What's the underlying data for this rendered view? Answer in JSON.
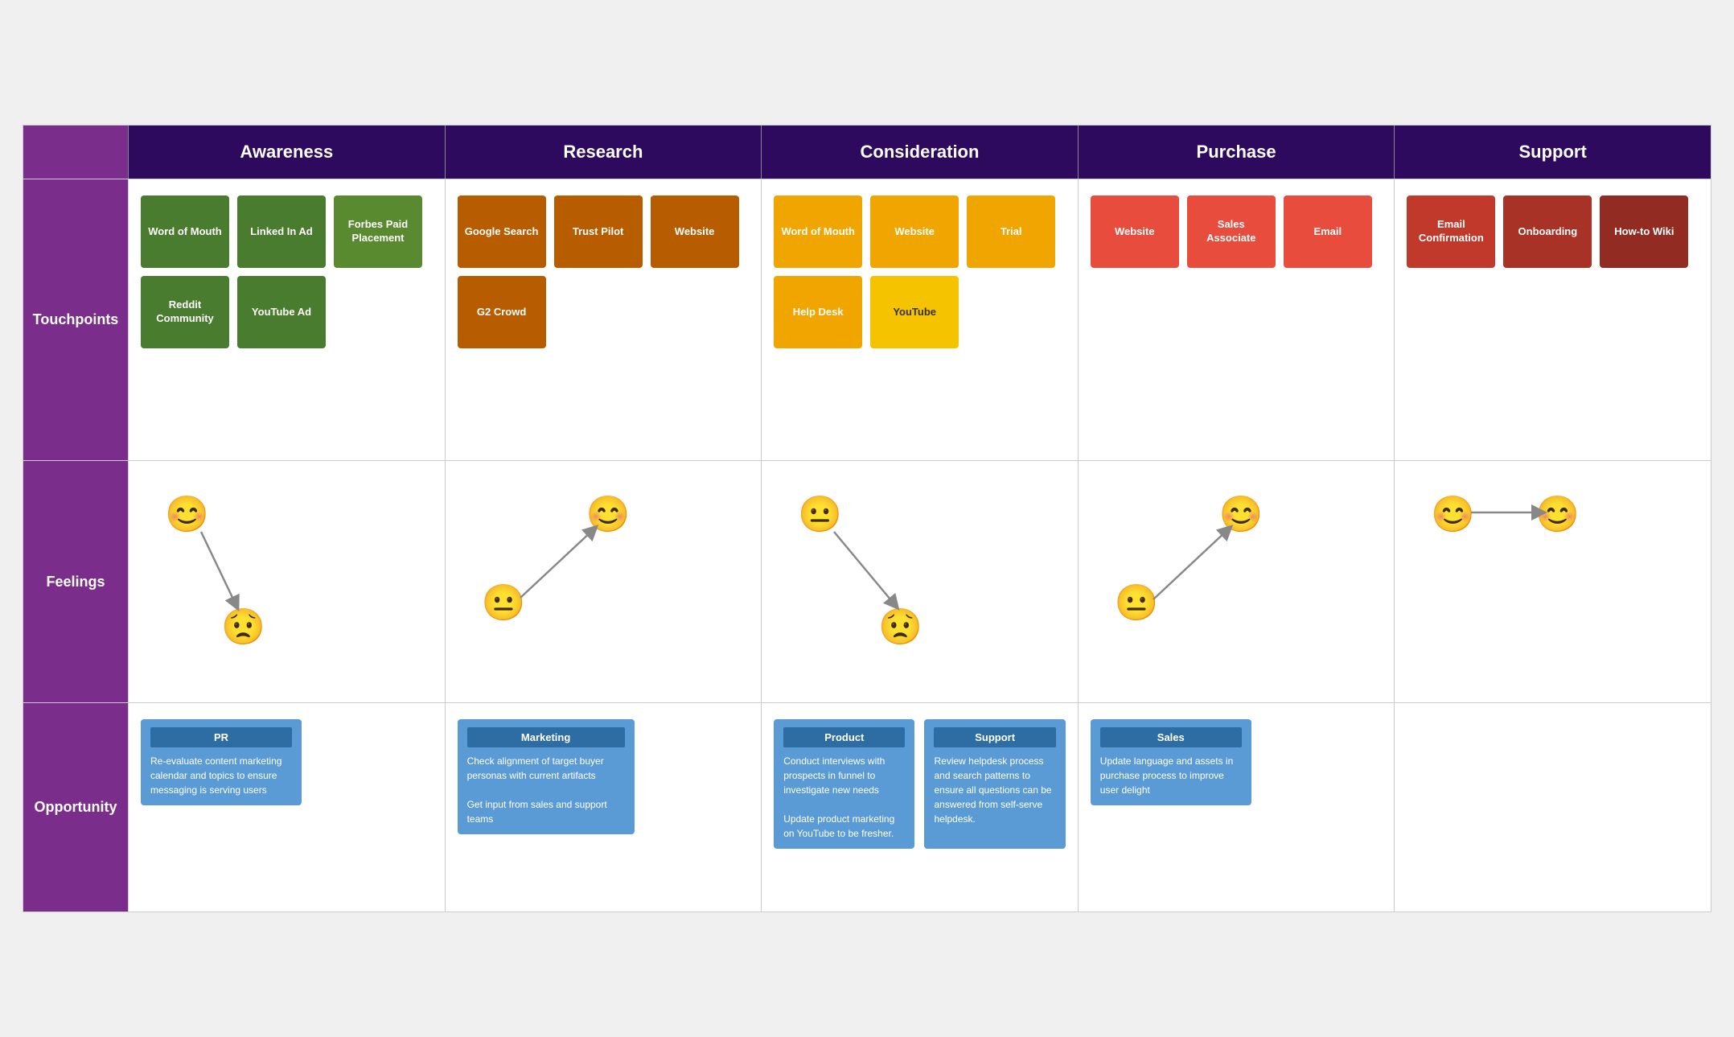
{
  "header": {
    "columns": [
      {
        "label": "Awareness"
      },
      {
        "label": "Research"
      },
      {
        "label": "Consideration"
      },
      {
        "label": "Purchase"
      },
      {
        "label": "Support"
      }
    ]
  },
  "rows": {
    "touchpoints": {
      "label": "Touchpoints",
      "awareness": [
        {
          "text": "Word of Mouth",
          "color": "green-dark"
        },
        {
          "text": "Linked In Ad",
          "color": "green-dark"
        },
        {
          "text": "Forbes Paid Placement",
          "color": "green-mid"
        },
        {
          "text": "Reddit Community",
          "color": "green-dark"
        },
        {
          "text": "YouTube Ad",
          "color": "green-dark"
        }
      ],
      "research": [
        {
          "text": "Google Search",
          "color": "orange-dark"
        },
        {
          "text": "Trust Pilot",
          "color": "orange-dark"
        },
        {
          "text": "Website",
          "color": "orange-dark"
        },
        {
          "text": "G2 Crowd",
          "color": "orange-dark"
        }
      ],
      "consideration": [
        {
          "text": "Word of Mouth",
          "color": "orange-light"
        },
        {
          "text": "Website",
          "color": "orange-light"
        },
        {
          "text": "Trial",
          "color": "orange-light"
        },
        {
          "text": "Help Desk",
          "color": "orange-light"
        },
        {
          "text": "YouTube",
          "color": "yellow-light"
        }
      ],
      "purchase": [
        {
          "text": "Website",
          "color": "red-mid"
        },
        {
          "text": "Sales Associate",
          "color": "red-mid"
        },
        {
          "text": "Email",
          "color": "red-mid"
        }
      ],
      "support": [
        {
          "text": "Email Confirmation",
          "color": "red-dark"
        },
        {
          "text": "Onboarding",
          "color": "pink-dark"
        },
        {
          "text": "How-to Wiki",
          "color": "crimson"
        }
      ]
    },
    "feelings": {
      "label": "Feelings"
    },
    "opportunity": {
      "label": "Opportunity",
      "awareness": {
        "title": "PR",
        "text": "Re-evaluate content marketing calendar and topics to ensure messaging is serving users"
      },
      "research": {
        "title": "Marketing",
        "text": "Check alignment of target buyer personas with current artifacts\n\nGet input from sales and support teams"
      },
      "consideration": [
        {
          "title": "Product",
          "text": "Conduct interviews with prospects in funnel to investigate new needs\n\nUpdate product marketing on YouTube to be fresher."
        },
        {
          "title": "Support",
          "text": "Review helpdesk process and search patterns to ensure all questions can be answered from self-serve helpdesk."
        }
      ],
      "purchase": {
        "title": "Sales",
        "text": "Update language and assets in purchase process to improve user delight"
      }
    }
  }
}
